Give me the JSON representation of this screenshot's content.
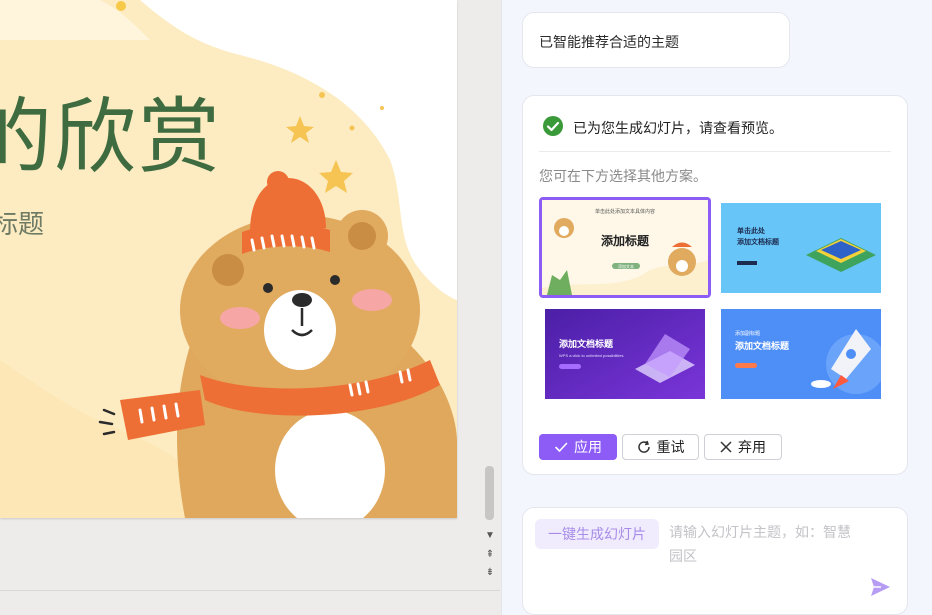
{
  "slide": {
    "title": "的欣赏",
    "subtitle": "标题"
  },
  "panel": {
    "user_message": "已智能推荐合适的主题",
    "result": {
      "heading": "已为您生成幻灯片，请查看预览。",
      "hint": "您可在下方选择其他方案。",
      "themes": [
        {
          "top_line": "单击此处添加文本具体内容",
          "title": "添加标题",
          "button": "添加文本",
          "selected": true
        },
        {
          "top_line": "单击此处",
          "title": "添加文档标题",
          "selected": false
        },
        {
          "title": "添加文档标题",
          "subtitle": "WPS a click to unlimited possibilities",
          "selected": false
        },
        {
          "top_line": "添加副标题",
          "title": "添加文档标题",
          "selected": false
        }
      ],
      "actions": {
        "apply": "应用",
        "retry": "重试",
        "discard": "弃用"
      }
    },
    "input": {
      "generate_label": "一键生成幻灯片",
      "placeholder": "请输入幻灯片主题，如：智慧园区"
    }
  },
  "colors": {
    "accent": "#8d5cf6",
    "title_green": "#3e6b3f",
    "bear_brown": "#d9a35a",
    "scarf_orange": "#ee6f35"
  }
}
